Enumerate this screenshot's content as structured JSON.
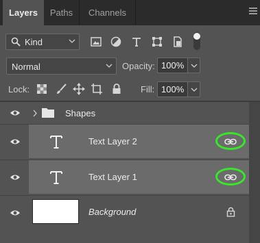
{
  "tabs": [
    {
      "label": "Layers",
      "active": true
    },
    {
      "label": "Paths",
      "active": false
    },
    {
      "label": "Channels",
      "active": false
    }
  ],
  "filter": {
    "kind_label": "Kind",
    "icons": [
      "image-filter-icon",
      "adjustment-filter-icon",
      "type-filter-icon",
      "shape-filter-icon",
      "smart-object-filter-icon",
      "filter-toggle-icon"
    ]
  },
  "blend": {
    "mode": "Normal",
    "opacity_label": "Opacity:",
    "opacity_value": "100%"
  },
  "lock": {
    "label": "Lock:",
    "fill_label": "Fill:",
    "fill_value": "100%"
  },
  "layers": [
    {
      "name": "Shapes",
      "type": "group",
      "visible": true
    },
    {
      "name": "Text Layer 2",
      "type": "text",
      "visible": true,
      "linked": true,
      "selected": true
    },
    {
      "name": "Text Layer 1",
      "type": "text",
      "visible": true,
      "linked": true,
      "selected": true
    },
    {
      "name": "Background",
      "type": "background",
      "visible": true,
      "locked": true
    }
  ],
  "colors": {
    "panel_bg": "#535353",
    "tabbar_bg": "#2b2b2b",
    "selected_row": "#6b6b6b",
    "highlight_ring": "#34e82a"
  }
}
